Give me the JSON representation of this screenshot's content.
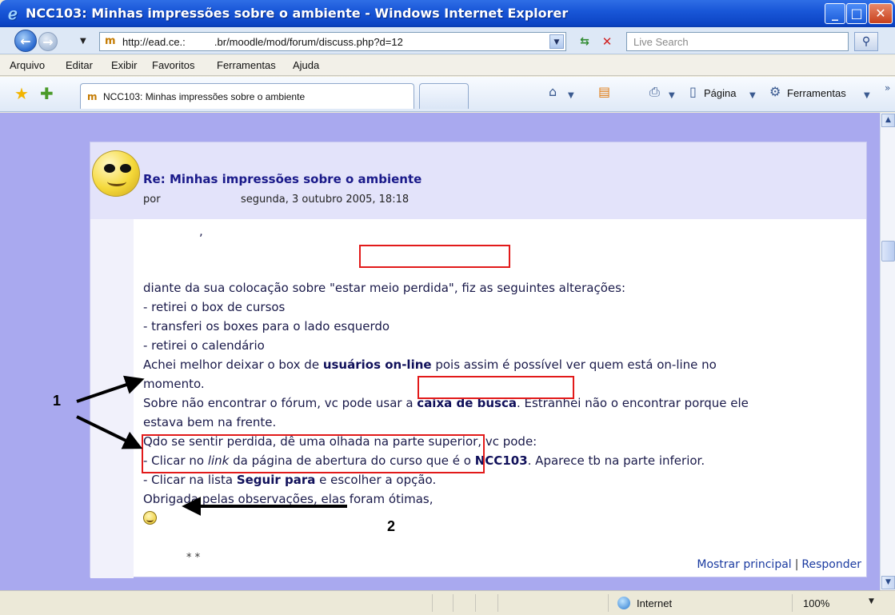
{
  "window": {
    "title": "NCC103: Minhas impressões sobre o ambiente - Windows Internet Explorer",
    "min_glyph": "_",
    "max_glyph": "□",
    "close_glyph": "✕"
  },
  "address_bar": {
    "url": "http://ead.ce.:          .br/moodle/mod/forum/discuss.php?d=12",
    "search_placeholder": "Live Search"
  },
  "menu": {
    "items": [
      "Arquivo",
      "Editar",
      "Exibir",
      "Favoritos",
      "Ferramentas",
      "Ajuda"
    ]
  },
  "tabs": {
    "active_label": "NCC103: Minhas impressões sobre o ambiente"
  },
  "command_bar": {
    "page_label": "Página",
    "tools_label": "Ferramentas"
  },
  "post": {
    "title": "Re: Minhas impressões sobre o ambiente",
    "by_label": "por",
    "date": "segunda, 3 outubro 2005, 18:18",
    "greeting_mark": ",",
    "lines": {
      "l1_pre": "diante da sua colocação sobre ",
      "l1_quote": "\"estar meio perdida\"",
      "l1_post": ", fiz as seguintes alterações:",
      "l2": "- retirei o box de cursos",
      "l3": "- transferi os boxes para o lado esquerdo",
      "l4": "- retirei o calendário",
      "l5_pre": "Achei melhor deixar o box de ",
      "l5_bold": "usuários on-line",
      "l5_post": " pois assim é possível ver quem está on-line no",
      "l6": "momento.",
      "l7_pre": "Sobre não encontrar o fórum, vc pode ",
      "l7_mid": "usar a ",
      "l7_bold": "caixa de busca",
      "l7_post": ". Estranhei não o encontrar porque ele",
      "l8": "estava bem na frente.",
      "l9": "Qdo se sentir perdida, dê uma olhada na parte superior, vc pode:",
      "l10_pre": "- Clicar no ",
      "l10_ital": "link",
      "l10_mid": " da página de abertura do curso que é o ",
      "l10_bold": "NCC103",
      "l10_post": ". Aparece tb na parte inferior.",
      "l11_pre": "- Clicar na lista ",
      "l11_bold": "Seguir para",
      "l11_post": " e escolher a opção.",
      "l12": "Obrigada pelas observações, elas foram ótimas,"
    },
    "signature_suffix": "* *",
    "link_show_parent": "Mostrar principal",
    "link_separator": "|",
    "link_reply": "Responder"
  },
  "annotations": {
    "label_1": "1",
    "label_2": "2"
  },
  "status_bar": {
    "zone": "Internet",
    "zoom": "100%"
  }
}
